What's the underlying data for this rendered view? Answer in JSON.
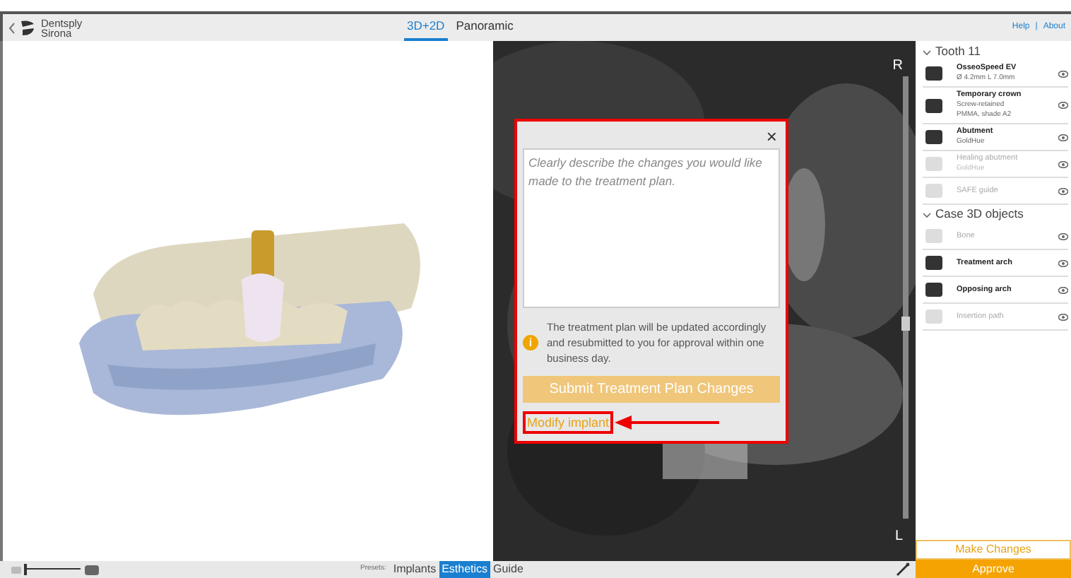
{
  "header": {
    "brand": [
      "Dentsply",
      "Sirona"
    ],
    "view_tabs": [
      {
        "label": "3D+2D",
        "selected": true
      },
      {
        "label": "Panoramic",
        "selected": false
      }
    ],
    "links": [
      "Help",
      "|",
      "About"
    ]
  },
  "viewer": {
    "markers": [
      "R",
      "L"
    ]
  },
  "dialog": {
    "close": "×",
    "placeholder": "Clearly describe the changes you would like made to the treatment plan.",
    "info_icon": "i",
    "info": "The treatment plan will be updated accordingly and resubmitted to you for approval within one business day.",
    "submit": "Submit Treatment Plan Changes",
    "link": "Modify implant"
  },
  "sidebar": {
    "sections": [
      {
        "title": "Tooth 11",
        "expanded": true,
        "items": [
          {
            "title": "OsseoSpeed EV",
            "details": [
              "Ø 4.2mm L 7.0mm"
            ],
            "disabled": false
          },
          {
            "title": "Temporary crown",
            "details": [
              "Screw-retained",
              "PMMA, shade A2"
            ],
            "disabled": false
          },
          {
            "title": "Abutment",
            "details": [
              "GoldHue"
            ],
            "disabled": false
          },
          {
            "title": "Healing abutment",
            "details": [
              "GoldHue"
            ],
            "disabled": true
          },
          {
            "title": "SAFE guide",
            "disabled": true
          }
        ]
      },
      {
        "title": "Case 3D objects",
        "expanded": true,
        "items": [
          {
            "title": "Bone",
            "disabled": true
          },
          {
            "title": "Treatment arch",
            "disabled": false
          },
          {
            "title": "Opposing arch",
            "disabled": false
          },
          {
            "title": "Insertion path",
            "disabled": true
          }
        ]
      }
    ]
  },
  "bottom": {
    "zoom": {
      "level": 0.0
    },
    "presets_label": "Presets:",
    "presets": [
      {
        "label": "Implants",
        "selected": false
      },
      {
        "label": "Esthetics",
        "selected": true
      },
      {
        "label": "Guide",
        "selected": false
      }
    ]
  },
  "actions": {
    "make_changes": "Make Changes",
    "approve": "Approve"
  }
}
